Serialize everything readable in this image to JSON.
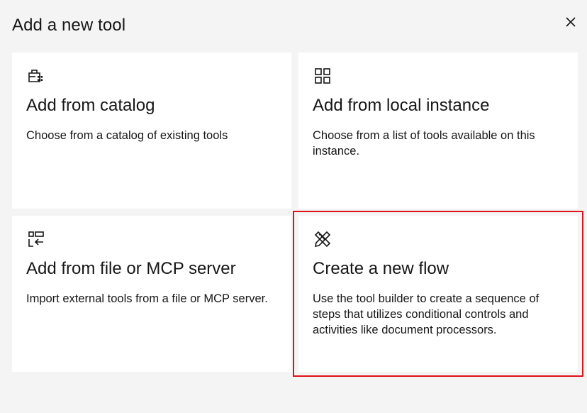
{
  "modal": {
    "title": "Add a new tool",
    "close_icon": "close-icon"
  },
  "tiles": [
    {
      "icon": "catalog-icon",
      "title": "Add from catalog",
      "description": "Choose from a catalog of existing tools"
    },
    {
      "icon": "grid-apps-icon",
      "title": "Add from local instance",
      "description": "Choose from a list of tools available on this instance."
    },
    {
      "icon": "import-file-icon",
      "title": "Add from file or MCP server",
      "description": "Import external tools from a file or MCP server."
    },
    {
      "icon": "tools-icon",
      "title": "Create a new flow",
      "description": "Use the tool builder to create a sequence of steps that utilizes conditional controls and activities like document processors."
    }
  ],
  "colors": {
    "background": "#f4f4f4",
    "tile": "#ffffff",
    "text": "#161616",
    "highlight": "#e0131a"
  }
}
